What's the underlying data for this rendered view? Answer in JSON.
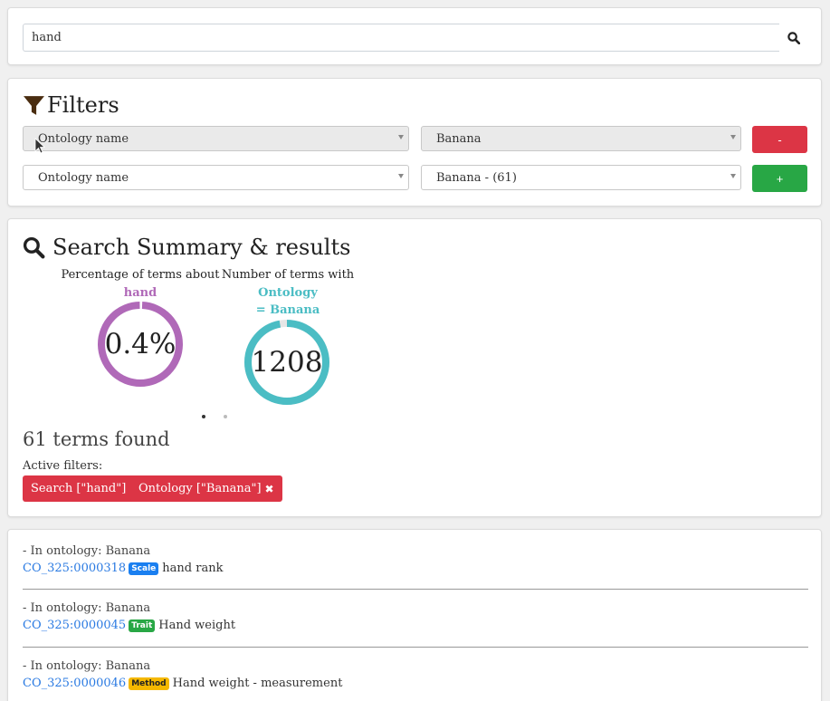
{
  "search": {
    "value": "hand"
  },
  "filters": {
    "title": "Filters",
    "rows": [
      {
        "field": "Ontology name",
        "value": "Banana",
        "action": "-"
      },
      {
        "field": "Ontology name",
        "value": "Banana - (61)",
        "action": "+"
      }
    ]
  },
  "summary": {
    "title": "Search Summary & results",
    "stats": [
      {
        "caption": "Percentage of terms about",
        "highlight": "hand",
        "value": "0.4%",
        "percent": 0.4,
        "color": "#b069b8"
      },
      {
        "caption": "Number of terms with",
        "highlight_1": "Ontology",
        "highlight_2": "= Banana",
        "value": "1208",
        "percent": 97,
        "color": "#4bbdc4"
      }
    ],
    "carousel": {
      "slides": 2,
      "active": 1
    },
    "terms_found": "61 terms found",
    "active_filters_label": "Active filters:",
    "chips": [
      {
        "label": "Search [\"hand\"]"
      },
      {
        "label": "Ontology [\"Banana\"]"
      }
    ]
  },
  "results": [
    {
      "ontology": "- In ontology: Banana",
      "id": "CO_325:0000318",
      "badge": "Scale",
      "badge_bg": "#1a7ff0",
      "badge_fg": "#ffffff",
      "label": "hand rank"
    },
    {
      "ontology": "- In ontology: Banana",
      "id": "CO_325:0000045",
      "badge": "Trait",
      "badge_bg": "#28a745",
      "badge_fg": "#ffffff",
      "label": "Hand weight"
    },
    {
      "ontology": "- In ontology: Banana",
      "id": "CO_325:0000046",
      "badge": "Method",
      "badge_bg": "#f5b800",
      "badge_fg": "#222222",
      "label": "Hand weight - measurement"
    }
  ],
  "icons": {
    "search": "search-icon",
    "filter": "filter-icon",
    "close": "close-icon",
    "dropdown": "caret-down-icon"
  }
}
